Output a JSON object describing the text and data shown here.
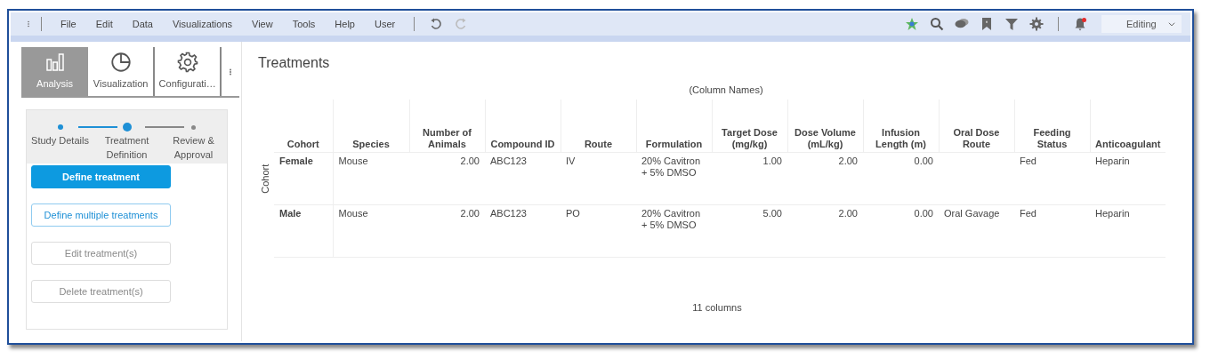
{
  "menu": [
    "File",
    "Edit",
    "Data",
    "Visualizations",
    "View",
    "Tools",
    "Help",
    "User"
  ],
  "history": [
    {
      "kind": "undo",
      "disabled": false
    },
    {
      "kind": "redo",
      "disabled": true
    }
  ],
  "toolbar_icons": [
    {
      "kind": "star-gear"
    },
    {
      "kind": "search"
    },
    {
      "kind": "chat"
    },
    {
      "kind": "bookmark"
    },
    {
      "kind": "filter"
    },
    {
      "kind": "settings"
    }
  ],
  "notifications": {
    "unread": true
  },
  "mode": "Editing",
  "tabs": [
    {
      "label": "Analysis",
      "kind": "bars",
      "selected": true
    },
    {
      "label": "Visualization",
      "kind": "pie",
      "selected": false
    },
    {
      "label": "Configurati…",
      "kind": "gear",
      "selected": false
    }
  ],
  "steps": [
    {
      "label": "Study Details",
      "completed": true,
      "current": false
    },
    {
      "label": "Treatment Definition",
      "completed": false,
      "current": true
    },
    {
      "label": "Review & Approval",
      "completed": false,
      "current": false
    }
  ],
  "actions": [
    {
      "label": "Define treatment",
      "kind": "primary",
      "disabled": false
    },
    {
      "label": "Define multiple treatments",
      "kind": "outline",
      "disabled": false
    },
    {
      "label": "Edit treatment(s)",
      "kind": "outline",
      "disabled": true
    },
    {
      "label": "Delete treatment(s)",
      "kind": "outline",
      "disabled": true
    }
  ],
  "panel": {
    "title": "Treatments"
  },
  "table": {
    "caption": "(Column Names)",
    "row_axis": "Cohort",
    "columns": [
      {
        "label": "Cohort",
        "kind": "header"
      },
      {
        "label": "Species",
        "kind": "text"
      },
      {
        "label": "Number of Animals",
        "kind": "number"
      },
      {
        "label": "Compound ID",
        "kind": "text"
      },
      {
        "label": "Route",
        "kind": "text"
      },
      {
        "label": "Formulation",
        "kind": "text"
      },
      {
        "label": "Target Dose (mg/kg)",
        "kind": "number"
      },
      {
        "label": "Dose Volume (mL/kg)",
        "kind": "number"
      },
      {
        "label": "Infusion Length (m)",
        "kind": "number"
      },
      {
        "label": "Oral Dose Route",
        "kind": "text"
      },
      {
        "label": "Feeding Status",
        "kind": "text"
      },
      {
        "label": "Anticoagulant",
        "kind": "text"
      }
    ],
    "rows": [
      [
        "Female",
        "Mouse",
        "2.00",
        "ABC123",
        "IV",
        "20% Cavitron + 5% DMSO",
        "1.00",
        "2.00",
        "0.00",
        "",
        "Fed",
        "Heparin"
      ],
      [
        "Male",
        "Mouse",
        "2.00",
        "ABC123",
        "PO",
        "20% Cavitron + 5% DMSO",
        "5.00",
        "2.00",
        "0.00",
        "Oral Gavage",
        "Fed",
        "Heparin"
      ]
    ],
    "footer": "11 columns"
  }
}
